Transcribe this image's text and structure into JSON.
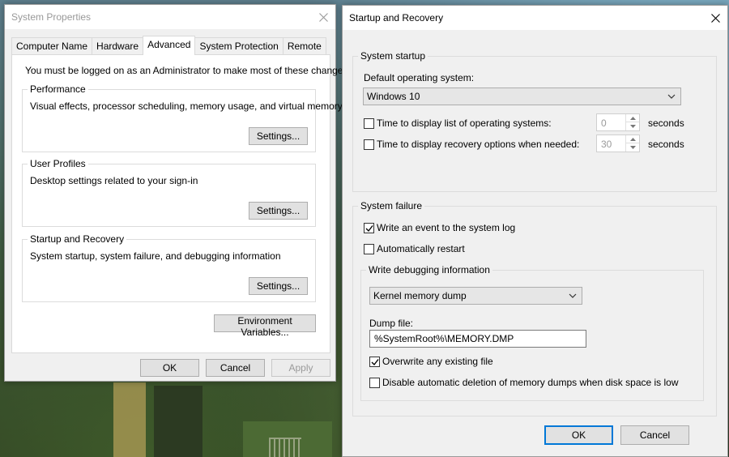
{
  "system_properties": {
    "title": "System Properties",
    "tabs": [
      "Computer Name",
      "Hardware",
      "Advanced",
      "System Protection",
      "Remote"
    ],
    "active_tab": "Advanced",
    "admin_notice": "You must be logged on as an Administrator to make most of these changes.",
    "performance": {
      "title": "Performance",
      "description": "Visual effects, processor scheduling, memory usage, and virtual memory",
      "button": "Settings..."
    },
    "user_profiles": {
      "title": "User Profiles",
      "description": "Desktop settings related to your sign-in",
      "button": "Settings..."
    },
    "startup_recovery": {
      "title": "Startup and Recovery",
      "description": "System startup, system failure, and debugging information",
      "button": "Settings..."
    },
    "env_button": "Environment Variables...",
    "ok": "OK",
    "cancel": "Cancel",
    "apply": "Apply"
  },
  "startup_and_recovery": {
    "title": "Startup and Recovery",
    "system_startup": {
      "title": "System startup",
      "default_os_label": "Default operating system:",
      "default_os_value": "Windows 10",
      "time_list_label": "Time to display list of operating systems:",
      "time_list_value": "0",
      "time_list_checked": false,
      "time_recovery_label": "Time to display recovery options when needed:",
      "time_recovery_value": "30",
      "time_recovery_checked": false,
      "seconds_label": "seconds"
    },
    "system_failure": {
      "title": "System failure",
      "write_event_label": "Write an event to the system log",
      "write_event_checked": true,
      "auto_restart_label": "Automatically restart",
      "auto_restart_checked": false
    },
    "debugging": {
      "title": "Write debugging information",
      "dump_type": "Kernel memory dump",
      "dump_file_label": "Dump file:",
      "dump_file_value": "%SystemRoot%\\MEMORY.DMP",
      "overwrite_label": "Overwrite any existing file",
      "overwrite_checked": true,
      "disable_delete_label": "Disable automatic deletion of memory dumps when disk space is low",
      "disable_delete_checked": false
    },
    "ok": "OK",
    "cancel": "Cancel"
  },
  "colors": {
    "accent": "#0078d7",
    "dialog_bg": "#f0f0f0",
    "disabled_text": "#9a9a9a"
  }
}
